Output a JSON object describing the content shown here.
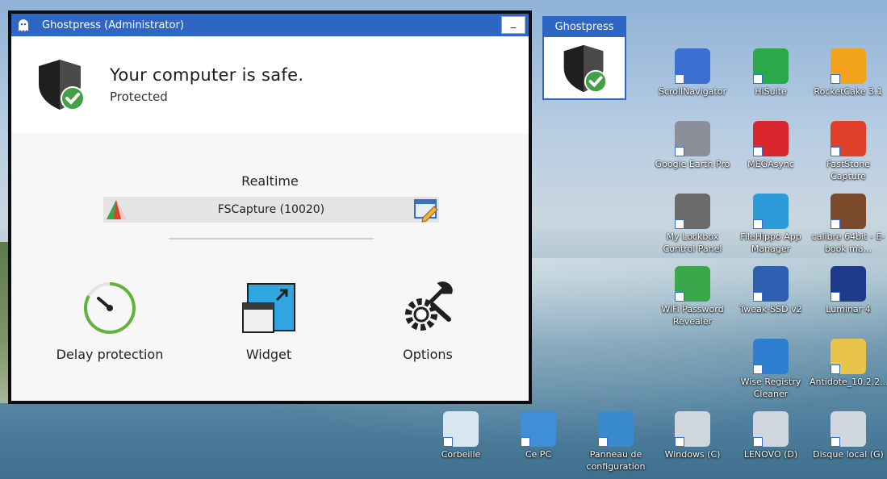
{
  "window": {
    "title": "Ghostpress (Administrator)",
    "minimize_label": "_",
    "status_title": "Your computer is safe.",
    "status_sub": "Protected",
    "realtime_label": "Realtime",
    "process_name": "FSCapture (10020)",
    "actions": [
      {
        "label": "Delay protection",
        "icon": "timer-icon"
      },
      {
        "label": "Widget",
        "icon": "widget-icon"
      },
      {
        "label": "Options",
        "icon": "gears-icon"
      }
    ]
  },
  "mini_widget": {
    "title": "Ghostpress"
  },
  "desktop_icons": [
    {
      "label": "ScrollNavigator",
      "color": "#3d6fd1"
    },
    {
      "label": "HiSuite",
      "color": "#2aa84a"
    },
    {
      "label": "RocketCake 3.1",
      "color": "#f2a21b"
    },
    {
      "label": "Google Earth Pro",
      "color": "#8a8f99"
    },
    {
      "label": "MEGAsync",
      "color": "#d9272e"
    },
    {
      "label": "FastStone Capture",
      "color": "#e0402a"
    },
    {
      "label": "My Lockbox Control Panel",
      "color": "#6b6b6b"
    },
    {
      "label": "FileHippo App Manager",
      "color": "#2d9ad9"
    },
    {
      "label": "calibre 64bit - E-book ma...",
      "color": "#7a4a2a"
    },
    {
      "label": "WiFi Password Revealer",
      "color": "#3aa84a"
    },
    {
      "label": "Tweak-SSD v2",
      "color": "#2f5fb0"
    },
    {
      "label": "Luminar 4",
      "color": "#1e3a8a"
    },
    {
      "label": "Wise Registry Cleaner",
      "color": "#2f7fd0"
    },
    {
      "label": "Antidote_10.2.2...",
      "color": "#e7c34a"
    },
    {
      "label": "Corbeille",
      "color": "#d7e6ef"
    },
    {
      "label": "Ce PC",
      "color": "#3f8fd8"
    },
    {
      "label": "Panneau de configuration",
      "color": "#3a8ad0"
    },
    {
      "label": "Windows (C)",
      "color": "#cfd6de"
    },
    {
      "label": "LENOVO (D)",
      "color": "#cfd6de"
    },
    {
      "label": "Disque local (G)",
      "color": "#cfd6de"
    }
  ]
}
